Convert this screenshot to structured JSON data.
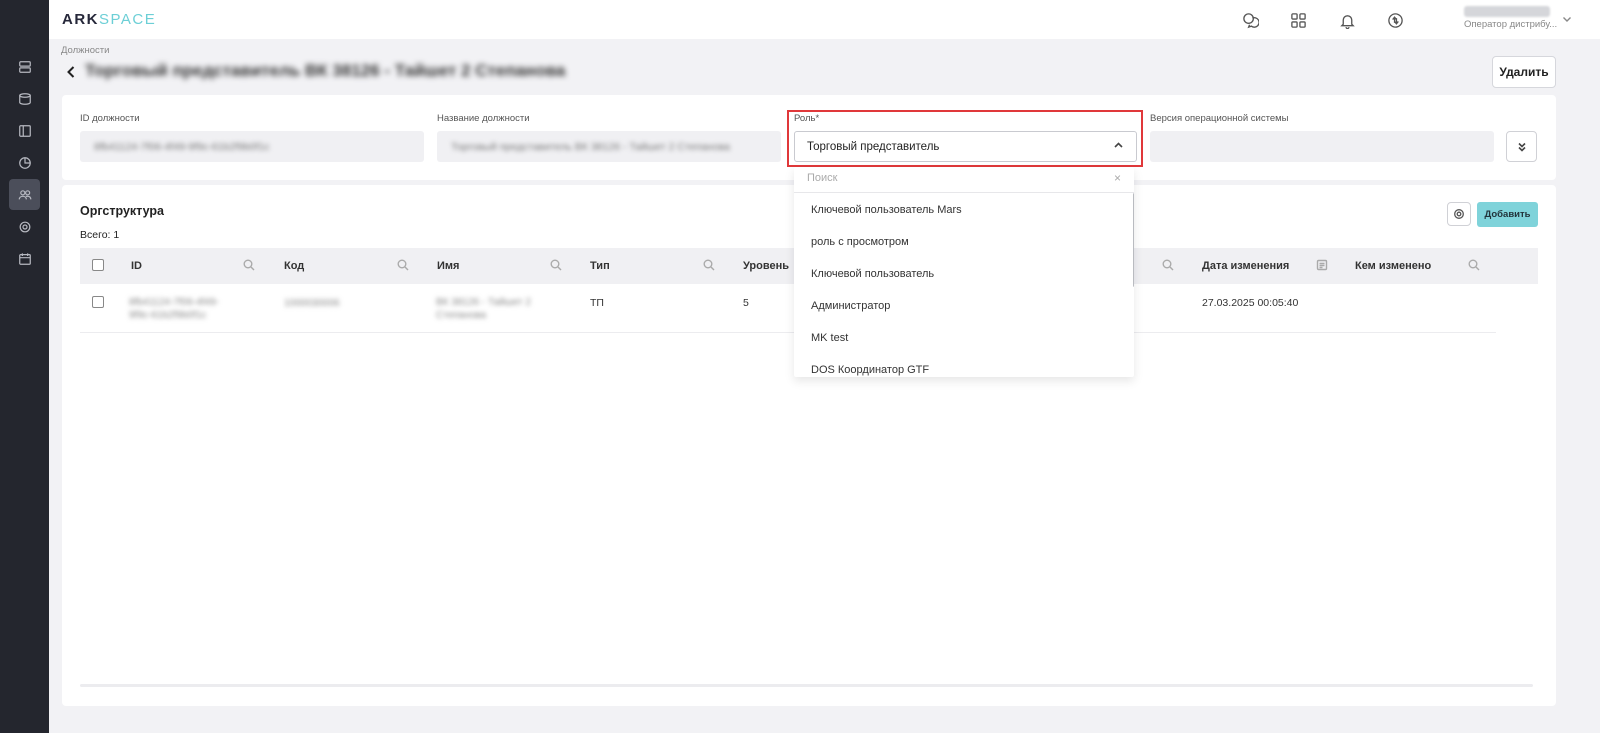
{
  "app": {
    "logo_ark": "ARK",
    "logo_space": "SPACE"
  },
  "user": {
    "role": "Оператор дистрибу..."
  },
  "breadcrumb": "Должности",
  "page": {
    "title": "Торговый представитель ВК 38126 - Тайшет 2 Степанова"
  },
  "actions": {
    "delete_label": "Удалить"
  },
  "form": {
    "id_label": "ID должности",
    "id_value": "8fb41124-7f06-4f49-9f9c-61b2f9b0f1c",
    "name_label": "Название должности",
    "name_value": "Торговый представитель ВК 38126 - Тайшет 2 Степанова",
    "role_label": "Роль*",
    "role_value": "Торговый представитель",
    "os_label": "Версия операционной системы",
    "os_value": ""
  },
  "dropdown": {
    "search_placeholder": "Поиск",
    "clear": "×",
    "options": [
      "Ключевой пользователь Mars",
      "роль с просмотром",
      "Ключевой пользователь",
      "Администратор",
      "MK test",
      "DOS Координатор GTF"
    ]
  },
  "table": {
    "title": "Оргструктура",
    "total": "Всего: 1",
    "add_label": "Добавить",
    "columns": [
      "ID",
      "Код",
      "Имя",
      "Тип",
      "Уровень",
      "Дата изменения",
      "Кем изменено"
    ],
    "rows": [
      {
        "id": "8fb41124-7f06-4f49-9f9c-61b2f9b0f1c",
        "code": "1000030006",
        "name": "ВК 38126 - Тайшет 2 Степанова",
        "type": "ТП",
        "level": "5",
        "modified_date": "27.03.2025 00:05:40",
        "modified_by": ""
      }
    ]
  }
}
